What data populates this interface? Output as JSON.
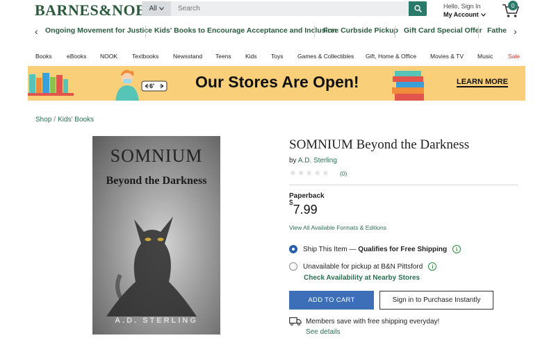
{
  "header": {
    "logo": "BARNES&NOBLE",
    "search_scope": "All",
    "search_placeholder": "Search",
    "account_greeting": "Hello, Sign In",
    "account_label": "My Account",
    "cart_count": "0"
  },
  "promos": [
    "Ongoing Movement for Justice",
    "Kids' Books to Encourage Acceptance and Inclusion",
    "Free Curbside Pickup",
    "Gift Card Special Offer",
    "Father"
  ],
  "categories": [
    "Books",
    "eBooks",
    "NOOK",
    "Textbooks",
    "Newsstand",
    "Teens",
    "Kids",
    "Toys",
    "Games & Collectibles",
    "Gift, Home & Office",
    "Movies & TV",
    "Music",
    "Sale"
  ],
  "banner": {
    "sign_text": "6'",
    "title": "Our Stores Are Open!",
    "cta": "LEARN MORE"
  },
  "breadcrumb": [
    "Shop",
    "Kids' Books"
  ],
  "cover": {
    "title": "SOMNIUM",
    "subtitle": "Beyond the Darkness",
    "author": "A.D. STERLING"
  },
  "product": {
    "title": "SOMNIUM Beyond the Darkness",
    "by": "by",
    "author": "A.D. Sterling",
    "stars": "★★★★★",
    "rating_count": "(0)",
    "rating": 0,
    "format": "Paperback",
    "price_symbol": "$",
    "price": "7.99",
    "formats_link": "View All Available Formats & Editions",
    "ship_option": "Ship This Item —",
    "ship_qualifier": "Qualifies for Free Shipping",
    "pickup_option": "Unavailable for pickup at B&N Pittsford",
    "check_availability": "Check Availability at Nearby Stores",
    "add_to_cart": "ADD TO CART",
    "sign_in_purchase": "Sign in to Purchase Instantly",
    "members_note": "Members save with free shipping everyday!",
    "see_details": "See details"
  },
  "colors": {
    "brand_green": "#2a5a3c",
    "link_green": "#2a6e52",
    "banner_yellow": "#f9cf7a",
    "cart_blue": "#3d6fb8",
    "sale_red": "#c0392b"
  }
}
